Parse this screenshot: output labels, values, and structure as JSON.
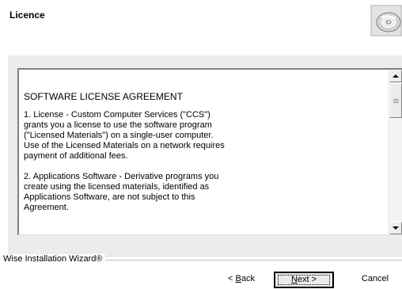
{
  "header": {
    "title": "Licence",
    "icon": "cd-rom-icon"
  },
  "license": {
    "heading": "SOFTWARE LICENSE AGREEMENT",
    "paragraphs": [
      {
        "lines": [
          "1.   License - Custom Computer Services (\"CCS\")",
          "grants you a license to use the software program",
          "(\"Licensed Materials\") on a single-user computer.",
          "Use of the Licensed Materials on a network requires",
          "payment of additional fees."
        ]
      },
      {
        "lines": [
          "2.   Applications Software - Derivative programs you",
          "create using the licensed materials, identified as",
          "Applications Software, are not subject to this",
          "Agreement."
        ]
      }
    ]
  },
  "footer": {
    "brand": "Wise Installation Wizard®"
  },
  "buttons": {
    "back": {
      "prefix": "< ",
      "mnemonic": "B",
      "rest": "ack"
    },
    "next": {
      "mnemonic": "N",
      "rest": "ext >"
    },
    "cancel": "Cancel"
  }
}
